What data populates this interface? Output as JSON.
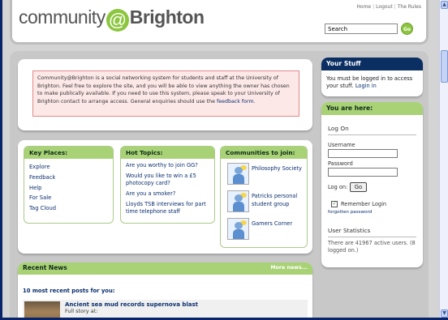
{
  "header": {
    "logo": {
      "left": "community",
      "at": "@",
      "brand": "Brighton"
    },
    "toplinks": [
      "Home",
      "Logout",
      "The Rules"
    ],
    "search": {
      "value": "Search",
      "go": "Go"
    }
  },
  "intro": {
    "text": "Community@Brighton is a social networking system for students and staff at the University of Brighton. Feel free to explore the site, and you will be able to view anything the owner has chosen to make publically available. If you need to use this system, please speak to your University of Brighton contact to arrange access. General enquiries should use the ",
    "link": "feedback form",
    "end": "."
  },
  "key_places": {
    "title": "Key Places:",
    "items": [
      "Explore",
      "Feedback",
      "Help",
      "For Sale",
      "Tag Cloud"
    ]
  },
  "hot_topics": {
    "title": "Hot Topics:",
    "items": [
      "Are you worthy to join GG?",
      "Would you like to win a £5 photocopy card?",
      "Are you a smoker?",
      "Lloyds TSB interviews for part time telephone staff"
    ]
  },
  "communities": {
    "title": "Communities to join:",
    "items": [
      "Philosophy Society",
      "Patricks personal student group",
      "Gamers Corner"
    ]
  },
  "news": {
    "title": "Recent News",
    "more": "More news...",
    "subtitle": "10 most recent posts for you:",
    "post_title": "Ancient sea mud records supernova blast",
    "post_body": "Full story at:"
  },
  "your_stuff": {
    "title": "Your Stuff",
    "text": "You must be logged in to access your stuff.",
    "link": "Login in"
  },
  "you_are_here": {
    "title": "You are here:",
    "log_on": "Log On",
    "username": "Username",
    "password": "Password",
    "log_on_label": "Log on:",
    "go_button": "Go",
    "remember": "Remember Login",
    "forgotten": "forgotten password",
    "stats_title": "User Statistics",
    "stats_text": "There are 41967 active users. (8 logged on.)"
  },
  "scroll": {
    "up": "▲",
    "down": "▼"
  }
}
